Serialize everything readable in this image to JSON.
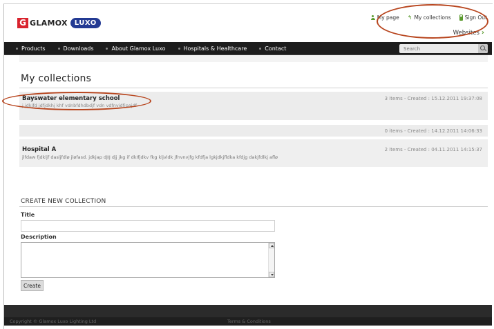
{
  "brand": {
    "g": "G",
    "glamox": "GLAMOX",
    "luxo": "LUXO"
  },
  "user_links": {
    "my_page": "My page",
    "my_collections": "My collections",
    "sign_out": "Sign Out"
  },
  "websites": {
    "label": "Websites",
    "chevron": "›"
  },
  "nav": {
    "items": [
      "Products",
      "Downloads",
      "About Glamox Luxo",
      "Hospitals & Healthcare",
      "Contact"
    ],
    "search_placeholder": "Search"
  },
  "page_title": "My collections",
  "collections": [
    {
      "name": "Bayswater elementary school",
      "description": "j jdkjfd jdfjdkhj khf vdnbfdhdbdjf vdn vdfnvidfjpajdf",
      "meta": "3 items - Created : 15.12.2011 19:37:08"
    },
    {
      "name": "",
      "description": "",
      "meta": "0 items - Created : 14.12.2011 14:06:33"
    },
    {
      "name": "Hospital A",
      "description": "jlfdaw fjdkljf dasljfdlø jløfasd. jdkjap dJIJ djj jkg if dkIfjdkv fkg kljvldk jfnvnvjfg kfdfja lgkjdkjfldka kfdjg dakjfdlkj aflø",
      "meta": "2 items - Created : 04.11.2011 14:15:37"
    }
  ],
  "create": {
    "heading": "CREATE NEW COLLECTION",
    "title_label": "Title",
    "title_value": "",
    "description_label": "Description",
    "description_value": "",
    "button": "Create"
  },
  "footer": {
    "copyright": "Copyright © Glamox Luxo Lighting Ltd",
    "terms": "Terms & Conditions"
  },
  "colors": {
    "accent_green": "#5a9a2e",
    "nav_bg": "#1d1d1d",
    "brand_red": "#d9232e",
    "brand_blue": "#233a93",
    "annotation": "#b8461f"
  }
}
